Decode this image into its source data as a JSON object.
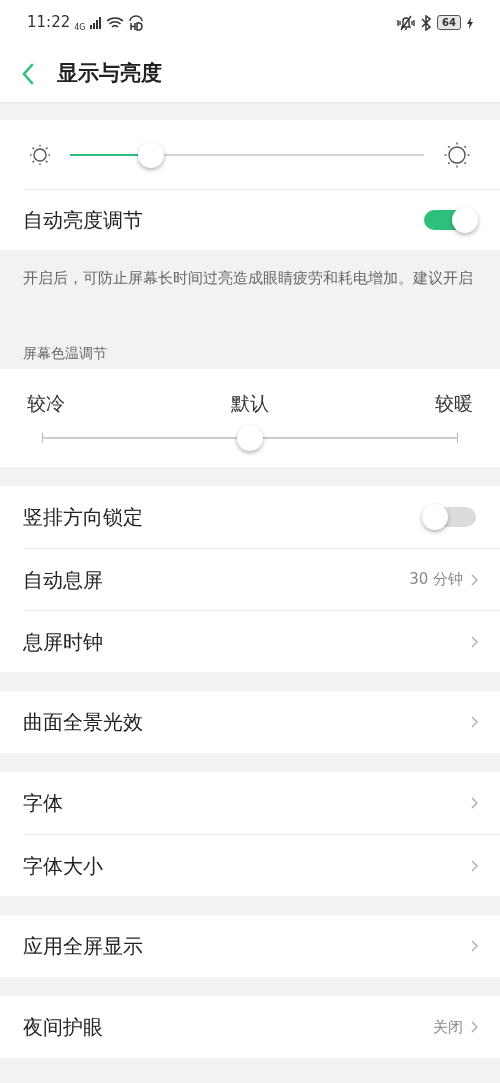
{
  "status_bar": {
    "time": "11:22",
    "network": "4G",
    "battery": "64"
  },
  "header": {
    "title": "显示与亮度"
  },
  "brightness": {
    "level": 0.23,
    "auto": {
      "label": "自动亮度调节",
      "on": true
    },
    "note": "开启后，可防止屏幕长时间过亮造成眼睛疲劳和耗电增加。建议开启"
  },
  "color_temp": {
    "heading": "屏幕色温调节",
    "labels": [
      "较冷",
      "默认",
      "较暖"
    ],
    "level": 0.5
  },
  "groups": [
    [
      {
        "kind": "toggle",
        "label": "竖排方向锁定",
        "on": false
      },
      {
        "kind": "link",
        "label": "自动息屏",
        "value": "30 分钟"
      },
      {
        "kind": "link",
        "label": "息屏时钟"
      }
    ],
    [
      {
        "kind": "link",
        "label": "曲面全景光效"
      }
    ],
    [
      {
        "kind": "link",
        "label": "字体"
      },
      {
        "kind": "link",
        "label": "字体大小"
      }
    ],
    [
      {
        "kind": "link",
        "label": "应用全屏显示"
      }
    ],
    [
      {
        "kind": "link",
        "label": "夜间护眼",
        "value": "关闭"
      }
    ]
  ]
}
